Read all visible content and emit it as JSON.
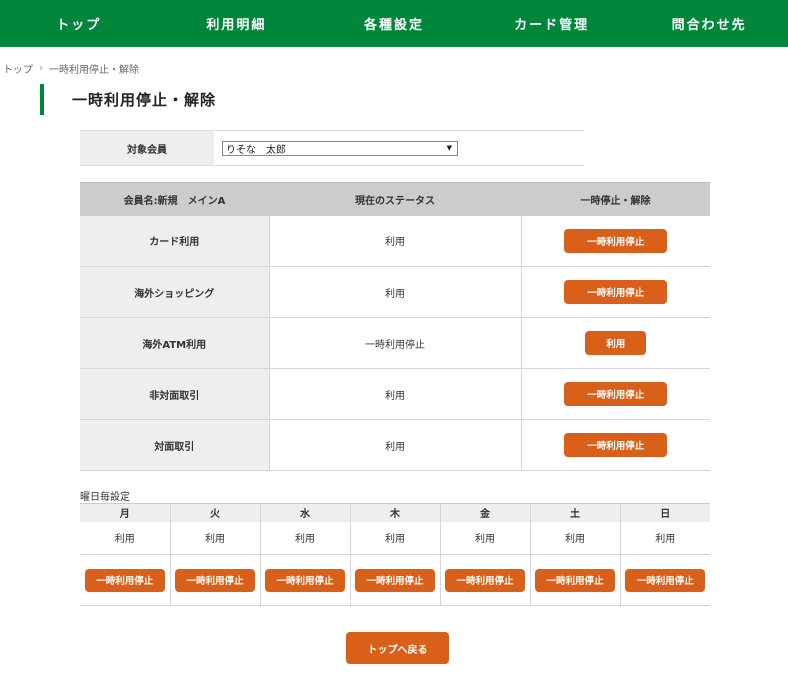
{
  "nav": {
    "items": [
      "トップ",
      "利用明細",
      "各種設定",
      "カード管理",
      "問合わせ先"
    ]
  },
  "breadcrumb": {
    "home": "トップ",
    "separator": "›",
    "current": "一時利用停止・解除"
  },
  "page": {
    "title": "一時利用停止・解除"
  },
  "member": {
    "label": "対象会員",
    "selected": "りそな　太郎"
  },
  "status_table": {
    "headers": [
      "会員名:新規　メインA",
      "現在のステータス",
      "一時停止・解除"
    ],
    "rows": [
      {
        "label": "カード利用",
        "status": "利用",
        "action": "一時利用停止"
      },
      {
        "label": "海外ショッピング",
        "status": "利用",
        "action": "一時利用停止"
      },
      {
        "label": "海外ATM利用",
        "status": "一時利用停止",
        "action": "利用"
      },
      {
        "label": "非対面取引",
        "status": "利用",
        "action": "一時利用停止"
      },
      {
        "label": "対面取引",
        "status": "利用",
        "action": "一時利用停止"
      }
    ]
  },
  "weekday": {
    "title": "曜日毎設定",
    "days": [
      {
        "day": "月",
        "status": "利用",
        "action": "一時利用停止"
      },
      {
        "day": "火",
        "status": "利用",
        "action": "一時利用停止"
      },
      {
        "day": "水",
        "status": "利用",
        "action": "一時利用停止"
      },
      {
        "day": "木",
        "status": "利用",
        "action": "一時利用停止"
      },
      {
        "day": "金",
        "status": "利用",
        "action": "一時利用停止"
      },
      {
        "day": "土",
        "status": "利用",
        "action": "一時利用停止"
      },
      {
        "day": "日",
        "status": "利用",
        "action": "一時利用停止"
      }
    ]
  },
  "footer": {
    "back_label": "トップへ戻る"
  },
  "colors": {
    "brand_green": "#00873c",
    "action_orange": "#d9601a",
    "header_gray": "#cccccc",
    "label_gray": "#eeeeee"
  }
}
